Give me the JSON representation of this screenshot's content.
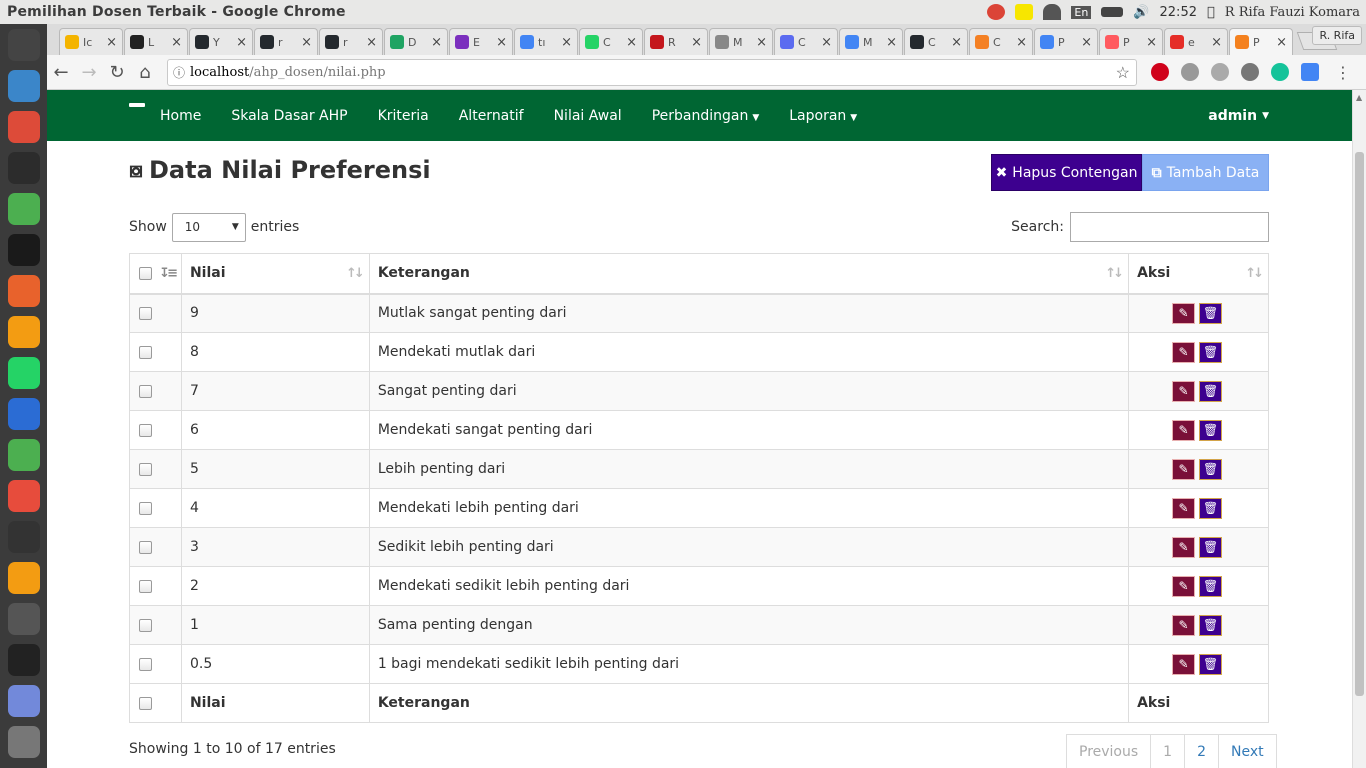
{
  "window": {
    "title": "Pemilihan Dosen Terbaik - Google Chrome"
  },
  "tray": {
    "lang": "En",
    "time": "22:52",
    "user": "R Rifa Fauzi Komara"
  },
  "launcher": {
    "colors": [
      "#444444",
      "#3b86c9",
      "#dd4b39",
      "#2c2c2c",
      "#4caf50",
      "#1a1a1a",
      "#e8622c",
      "#f39c12",
      "#25d366",
      "#2b6cd4",
      "#4caf50",
      "#e74c3c",
      "#333333",
      "#f39c12",
      "#555555",
      "#222222",
      "#7289da",
      "#777777"
    ]
  },
  "browser": {
    "tabs": [
      {
        "label": "Ic",
        "color": "#f4b400"
      },
      {
        "label": "L",
        "color": "#222222"
      },
      {
        "label": "Y",
        "color": "#24292e"
      },
      {
        "label": "r",
        "color": "#24292e"
      },
      {
        "label": "r",
        "color": "#24292e"
      },
      {
        "label": "D",
        "color": "#1fa463"
      },
      {
        "label": "E",
        "color": "#7b2fbe"
      },
      {
        "label": "tı",
        "color": "#4285f4"
      },
      {
        "label": "C",
        "color": "#25d366"
      },
      {
        "label": "R",
        "color": "#c4161c"
      },
      {
        "label": "M",
        "color": "#888888"
      },
      {
        "label": "C",
        "color": "#5b6bf0"
      },
      {
        "label": "M",
        "color": "#4285f4"
      },
      {
        "label": "C",
        "color": "#24292e"
      },
      {
        "label": "C",
        "color": "#f48024"
      },
      {
        "label": "P",
        "color": "#4285f4"
      },
      {
        "label": "P",
        "color": "#ff5a5f"
      },
      {
        "label": "e",
        "color": "#e52d27"
      },
      {
        "label": "P",
        "color": "#f4811f"
      }
    ],
    "profile": "R. Rifa",
    "url_host": "localhost",
    "url_path": "/ahp_dosen/nilai.php"
  },
  "nav": {
    "links": [
      "Home",
      "Skala Dasar AHP",
      "Kriteria",
      "Alternatif",
      "Nilai Awal"
    ],
    "dropdowns": [
      "Perbandingan",
      "Laporan"
    ],
    "user": "admin"
  },
  "page": {
    "title": "Data Nilai Preferensi",
    "btn_hapus": "Hapus Contengan",
    "btn_tambah": "Tambah Data"
  },
  "controls": {
    "show": "Show",
    "entries": "entries",
    "length": "10",
    "search": "Search:"
  },
  "table": {
    "headers": [
      "Nilai",
      "Keterangan",
      "Aksi"
    ],
    "rows": [
      {
        "nilai": "9",
        "ket": "Mutlak sangat penting dari"
      },
      {
        "nilai": "8",
        "ket": "Mendekati mutlak dari"
      },
      {
        "nilai": "7",
        "ket": "Sangat penting dari"
      },
      {
        "nilai": "6",
        "ket": "Mendekati sangat penting dari"
      },
      {
        "nilai": "5",
        "ket": "Lebih penting dari"
      },
      {
        "nilai": "4",
        "ket": "Mendekati lebih penting dari"
      },
      {
        "nilai": "3",
        "ket": "Sedikit lebih penting dari"
      },
      {
        "nilai": "2",
        "ket": "Mendekati sedikit lebih penting dari"
      },
      {
        "nilai": "1",
        "ket": "Sama penting dengan"
      },
      {
        "nilai": "0.5",
        "ket": "1 bagi mendekati sedikit lebih penting dari"
      }
    ]
  },
  "footer": {
    "info": "Showing 1 to 10 of 17 entries",
    "prev": "Previous",
    "p1": "1",
    "p2": "2",
    "next": "Next"
  }
}
